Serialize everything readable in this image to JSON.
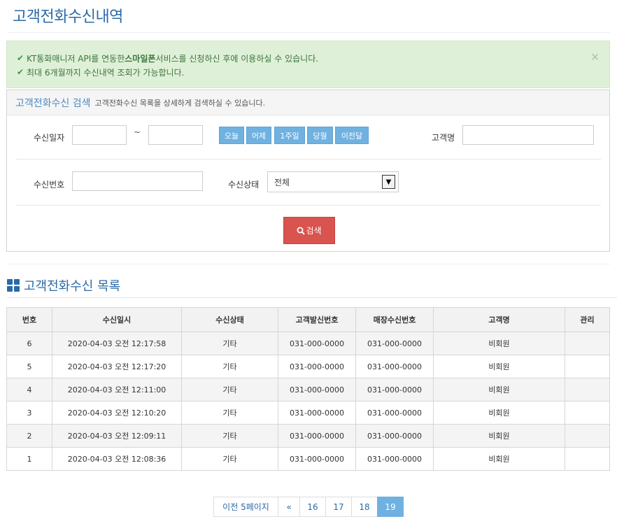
{
  "page": {
    "title": "고객전화수신내역"
  },
  "alert": {
    "line1_pre": "KT통화매니저 API를 연동한 ",
    "line1_bold": "스마일폰",
    "line1_post": " 서비스를 신청하신 후에 이용하실 수 있습니다.",
    "line2": "최대 6개월까지 수신내역 조회가 가능합니다.",
    "close": "×"
  },
  "search": {
    "title": "고객전화수신 검색",
    "desc": "고객전화수신 목록을 상세하게 검색하실 수 있습니다.",
    "date_label": "수신일자",
    "date_from": "",
    "date_to": "",
    "tilde": "~",
    "quick_buttons": [
      "오늘",
      "어제",
      "1주일",
      "당월",
      "이전달"
    ],
    "customer_label": "고객명",
    "customer_value": "",
    "number_label": "수신번호",
    "number_value": "",
    "status_label": "수신상태",
    "status_selected": "전체",
    "search_button": "검색"
  },
  "list": {
    "title": "고객전화수신 목록",
    "columns": [
      "번호",
      "수신일시",
      "수신상태",
      "고객발신번호",
      "매장수신번호",
      "고객명",
      "관리"
    ],
    "rows": [
      [
        "6",
        "2020-04-03 오전 12:17:58",
        "기타",
        "031-000-0000",
        "031-000-0000",
        "비회원",
        ""
      ],
      [
        "5",
        "2020-04-03 오전 12:17:20",
        "기타",
        "031-000-0000",
        "031-000-0000",
        "비회원",
        ""
      ],
      [
        "4",
        "2020-04-03 오전 12:11:00",
        "기타",
        "031-000-0000",
        "031-000-0000",
        "비회원",
        ""
      ],
      [
        "3",
        "2020-04-03 오전 12:10:20",
        "기타",
        "031-000-0000",
        "031-000-0000",
        "비회원",
        ""
      ],
      [
        "2",
        "2020-04-03 오전 12:09:11",
        "기타",
        "031-000-0000",
        "031-000-0000",
        "비회원",
        ""
      ],
      [
        "1",
        "2020-04-03 오전 12:08:36",
        "기타",
        "031-000-0000",
        "031-000-0000",
        "비회원",
        ""
      ]
    ]
  },
  "pager": {
    "prev5": "이전 5페이지",
    "first": "«",
    "pages": [
      "16",
      "17",
      "18",
      "19"
    ],
    "active": "19"
  },
  "colors": {
    "title_blue": "#2a6aa6",
    "alert_bg": "#dff0d8",
    "quick_button": "#6fb1e0",
    "search_button": "#d9534f"
  }
}
